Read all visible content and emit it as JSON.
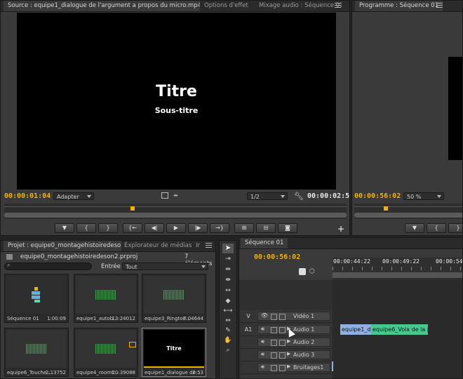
{
  "source_panel": {
    "tabs": [
      "Source : equipe1_dialogue de l'argument a propos du micro.mp4",
      "Options d'effet",
      "Mixage audio : Séquence 01"
    ],
    "video_title": "Titre",
    "video_subtitle": "Sous-titre",
    "timecode_current": "00:00:01:04",
    "fit_dropdown": "Adapter",
    "resolution_dropdown": "1/2",
    "timecode_duration": "00:00:02:53"
  },
  "program_panel": {
    "tab": "Programme : Séquence 01",
    "timecode_current": "00:00:56:02",
    "zoom_dropdown": "50 %"
  },
  "project_panel": {
    "tabs": [
      "Projet : equipe0_montagehistoiredeson2",
      "Explorateur de médias",
      "Ir"
    ],
    "file_name": "equipe0_montagehistoiredeson2.prproj",
    "item_count": "7 éléments",
    "input_label": "Entrée :",
    "input_value": "Tout",
    "items": [
      {
        "name": "Séquence 01",
        "duration": "1:00:09",
        "kind": "sequence"
      },
      {
        "name": "equipe1_autob...",
        "duration": "13:24012",
        "kind": "audio"
      },
      {
        "name": "equipe3_Rington...",
        "duration": "7:04644",
        "kind": "audio"
      },
      {
        "name": "equipe6_Touche...",
        "duration": "2:13752",
        "kind": "audio"
      },
      {
        "name": "equipe4_roomt...",
        "duration": "20:39088",
        "kind": "audio"
      },
      {
        "name": "equipe1_dialogue de...",
        "duration": "2:53",
        "kind": "video",
        "thumb_title": "Titre"
      }
    ]
  },
  "timeline_panel": {
    "tab": "Séquence 01",
    "timecode": "00:00:56:02",
    "ruler": [
      "00:00:44:22",
      "00:00:49:22",
      "00:00:54:2"
    ],
    "tracks": [
      {
        "id": "V",
        "name": "Vidéo 1"
      },
      {
        "id": "A1",
        "name": "Audio 1"
      },
      {
        "id": "",
        "name": "Audio 2"
      },
      {
        "id": "",
        "name": "Audio 3"
      },
      {
        "id": "",
        "name": "Bruitages1"
      }
    ],
    "clips": [
      {
        "label": "equipe1_di",
        "color": "#8fb0e0"
      },
      {
        "label": "equipe6_Voix de la p",
        "color": "#45c98f"
      }
    ]
  },
  "colors": {
    "timecode": "#f2b200",
    "panel_bg": "#3a3a3a",
    "video_bg": "#000000"
  }
}
